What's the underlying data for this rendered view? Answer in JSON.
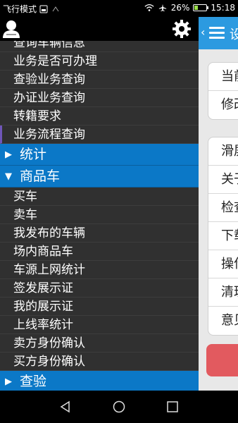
{
  "status_bar": {
    "carrier": "飞行模式",
    "battery_percent": "26%",
    "battery_level": 0.26,
    "time": "15:18"
  },
  "drawer": {
    "icons": {
      "avatar": "user-avatar-icon",
      "settings": "gear-icon"
    },
    "items_top": [
      "查询车辆信息",
      "业务是否可办理",
      "查验业务查询",
      "办证业务查询",
      "转籍要求",
      "业务流程查询"
    ],
    "section_stats": "统计",
    "section_goods": "商品车",
    "items_goods": [
      "买车",
      "卖车",
      "我发布的车辆",
      "场内商品车",
      "车源上网统计",
      "签发展示证",
      "我的展示证",
      "上线率统计",
      "卖方身份确认",
      "买方身份确认"
    ],
    "section_inspect": "查验"
  },
  "right_panel": {
    "title_fragment": "设",
    "group1": [
      "当前",
      "修改"
    ],
    "group2": [
      "滑屏",
      "关于",
      "检查",
      "下载",
      "操作",
      "清理",
      "意见"
    ],
    "colors": {
      "accent": "#2c9ae0",
      "danger": "#e25a5f",
      "section": "#0b78c7"
    }
  },
  "nav_bar": {
    "back": "back-icon",
    "home": "home-icon",
    "recents": "recents-icon"
  }
}
